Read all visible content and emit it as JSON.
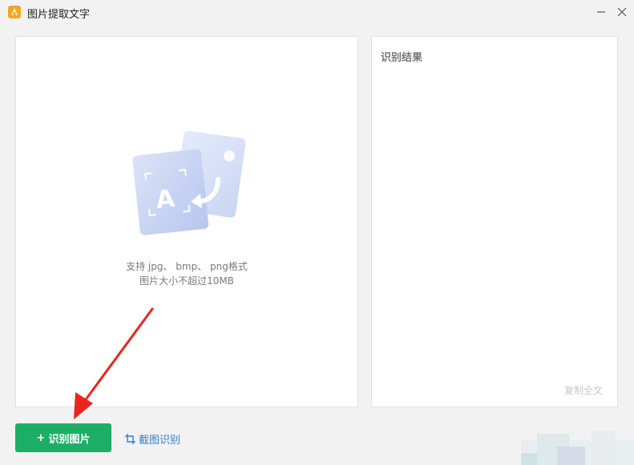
{
  "window": {
    "title": "图片提取文字"
  },
  "upload": {
    "hint_line1": "支持 jpg、 bmp、 png格式",
    "hint_line2": "图片大小不超过10MB"
  },
  "result": {
    "title": "识别结果",
    "copy_all_label": "复制全文"
  },
  "actions": {
    "recognize_label": "识别图片",
    "recognize_plus": "+",
    "screenshot_label": "截图识别"
  },
  "colors": {
    "primary_green": "#1dae66",
    "link_blue": "#2e7fd6",
    "annotation_red": "#e8261f"
  },
  "icons": [
    "app-icon",
    "minimize-icon",
    "close-icon",
    "image-text-illustration",
    "crop-icon"
  ]
}
